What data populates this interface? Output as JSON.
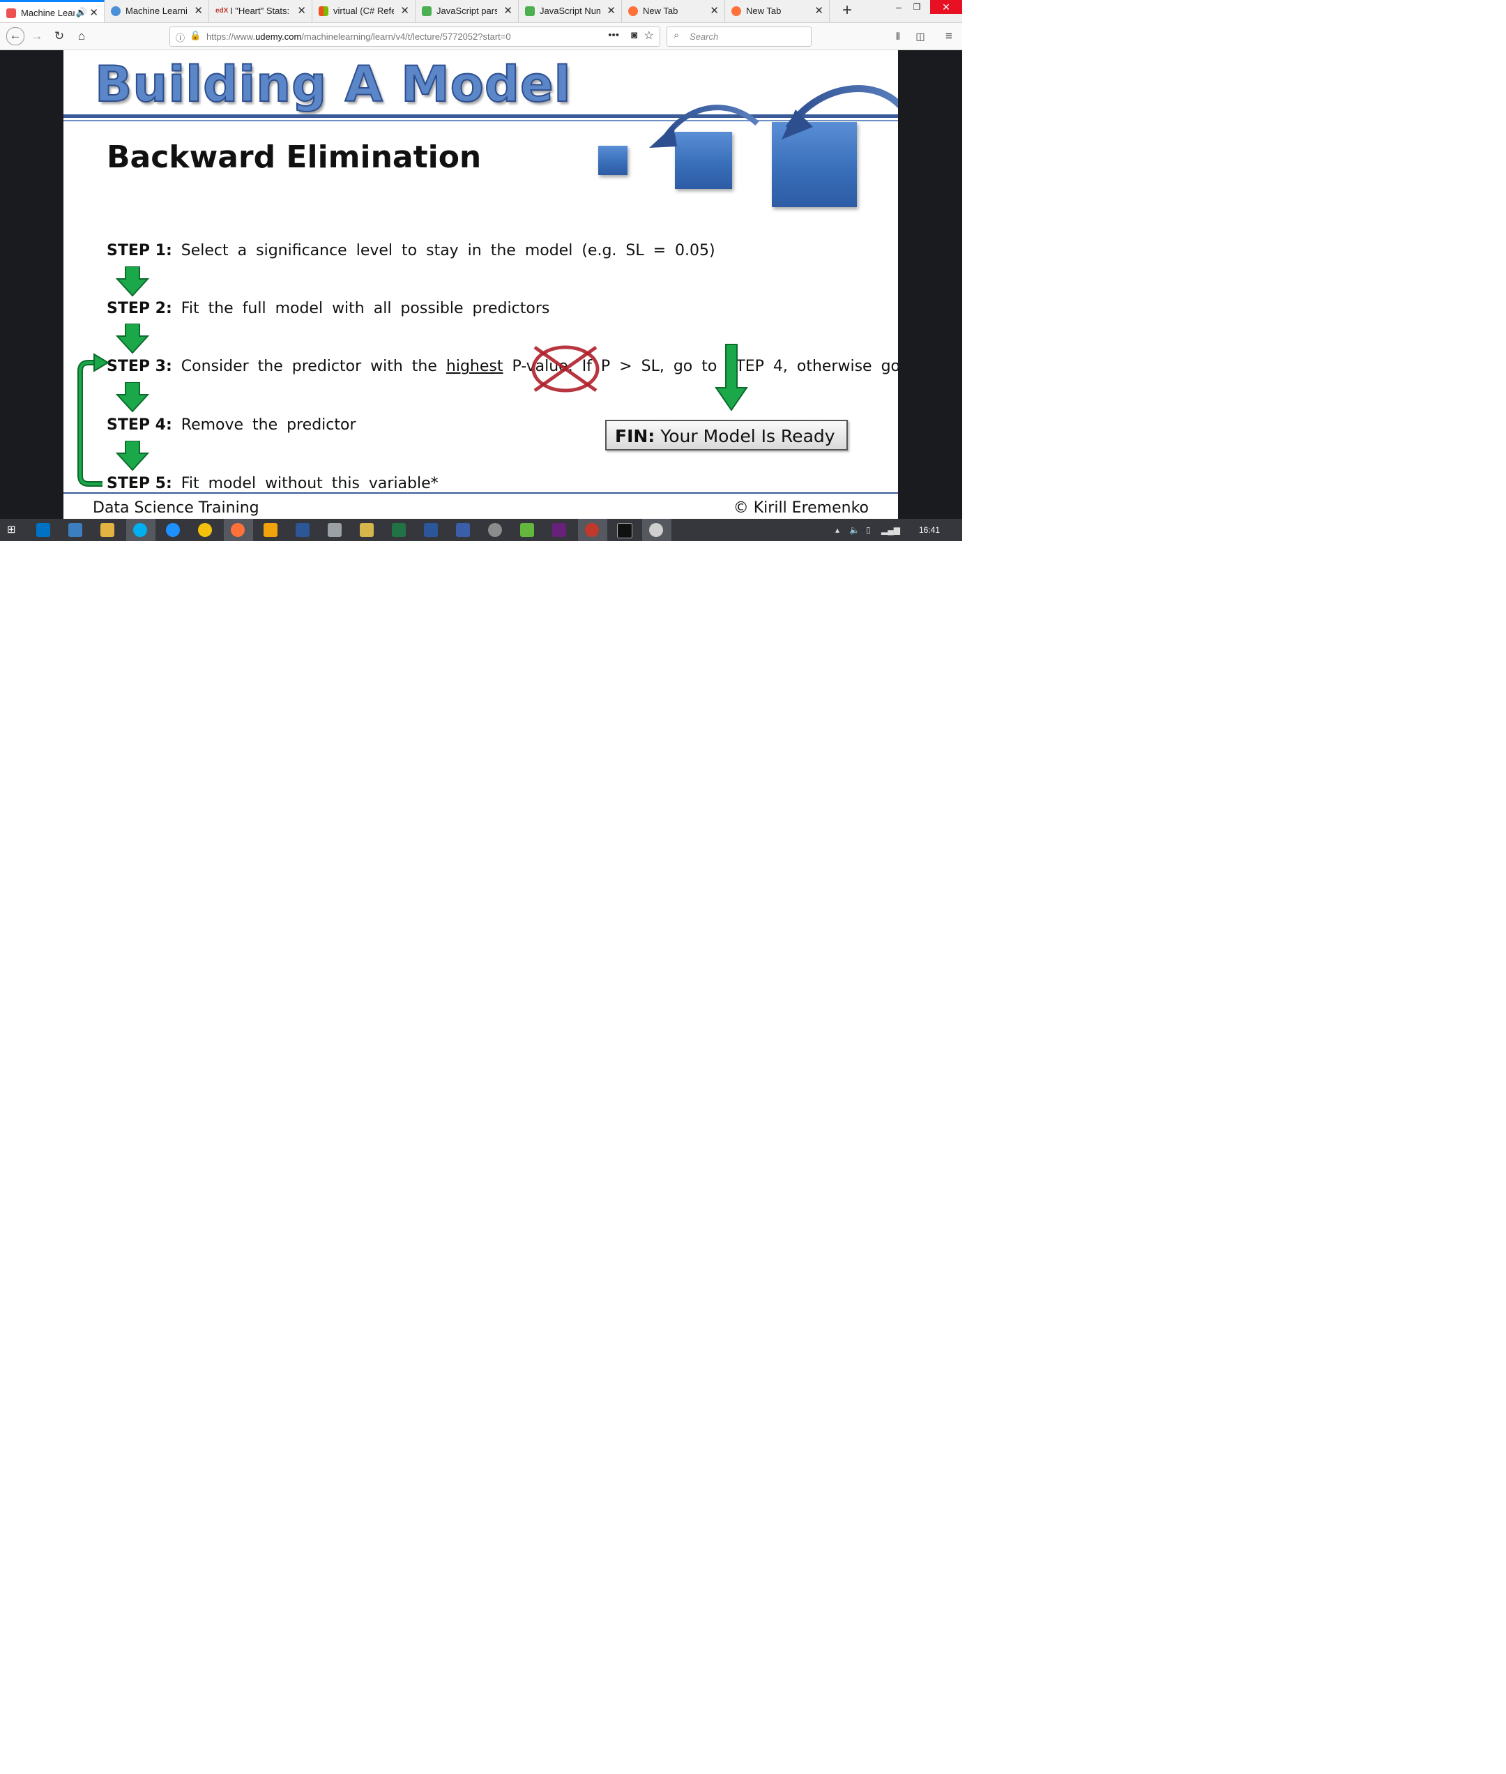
{
  "browser": {
    "tabs": [
      {
        "title": "Machine Lear",
        "favicon_color": "#ec5252",
        "active": true,
        "audio": true
      },
      {
        "title": "Machine Learnin",
        "favicon_color": "#4a90d9"
      },
      {
        "title": "I \"Heart\" Stats: Le",
        "favicon_color": "#c0392b",
        "prefix": "edX"
      },
      {
        "title": "virtual (C# Refere",
        "favicon_color": "#f25022"
      },
      {
        "title": "JavaScript parseFl",
        "favicon_color": "#4caf50"
      },
      {
        "title": "JavaScript Numb",
        "favicon_color": "#4caf50"
      },
      {
        "title": "New Tab",
        "favicon_color": "#ff7139"
      },
      {
        "title": "New Tab",
        "favicon_color": "#ff7139"
      }
    ],
    "new_tab_label": "+",
    "window_controls": {
      "minimize": "–",
      "restore": "❐",
      "close": "✕"
    },
    "url_prefix": "https://www.",
    "url_domain": "udemy.com",
    "url_path": "/machinelearning/learn/v4/t/lecture/5772052?start=0",
    "search_placeholder": "Search",
    "nav_icons": {
      "back": "back-arrow-icon",
      "forward": "forward-arrow-icon",
      "reload": "reload-icon",
      "home": "home-icon"
    }
  },
  "slide": {
    "title": "Building A Model",
    "subtitle": "Backward Elimination",
    "steps": [
      {
        "label": "STEP 1:",
        "text": "Select a significance level to stay in the model (e.g. SL = 0.05)"
      },
      {
        "label": "STEP 2:",
        "text": "Fit the full model with all possible predictors"
      },
      {
        "label": "STEP 3:",
        "text_a": "Consider the predictor with the",
        "text_b": "highest",
        "text_c": "P-value. If P > SL, go to STEP 4, otherwise go to FIN"
      },
      {
        "label": "STEP 4:",
        "text": "Remove the predictor"
      },
      {
        "label": "STEP 5:",
        "text": "Fit model without this variable*"
      }
    ],
    "fin_label": "FIN:",
    "fin_text": "Your Model Is Ready",
    "footer_left": "Data Science Training",
    "footer_right": "© Kirill Eremenko",
    "colors": {
      "title_blue": "#5b86c8",
      "rule_blue": "#3a5b97",
      "arrow_green": "#1aa84a",
      "cross_red": "#b0202a"
    }
  },
  "taskbar": {
    "clock": "16:41"
  }
}
